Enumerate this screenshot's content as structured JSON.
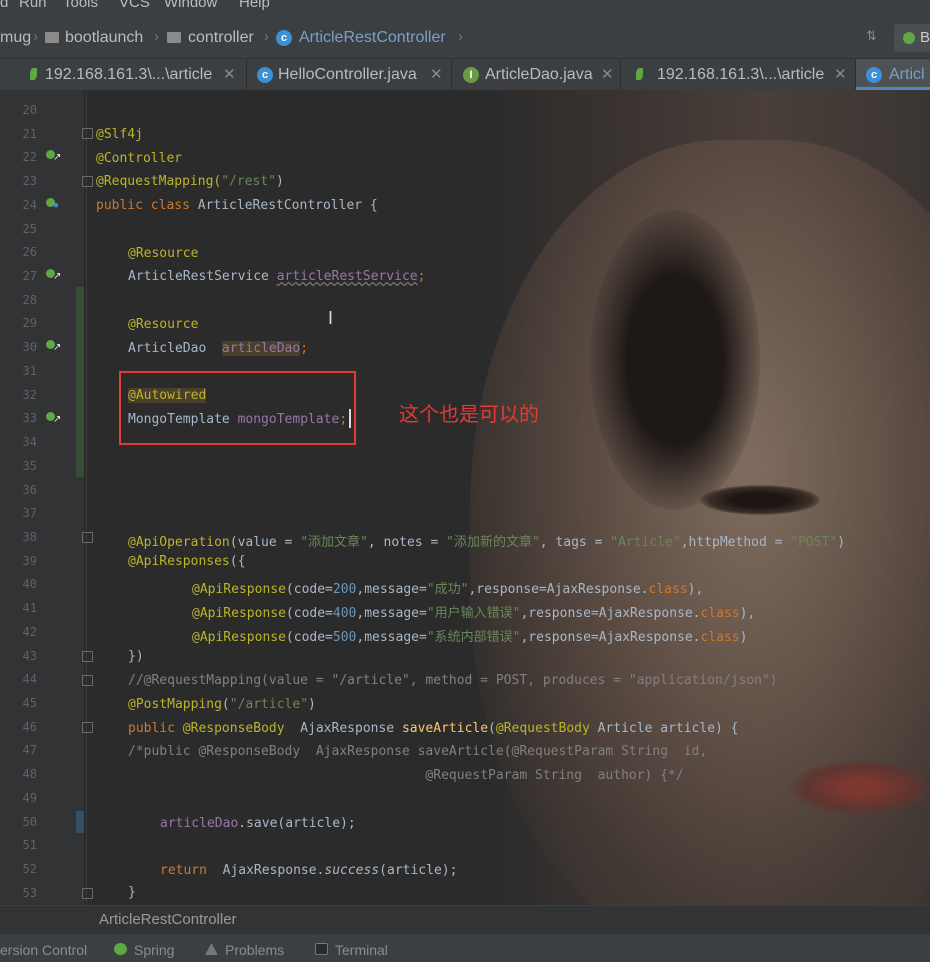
{
  "menu": {
    "items": [
      "d",
      "Run",
      "Tools",
      "VCS",
      "Window",
      "Help"
    ]
  },
  "breadcrumb": {
    "items": [
      "mug",
      "bootlaunch",
      "controller",
      "ArticleRestController"
    ],
    "right_label": "B"
  },
  "tabs": [
    {
      "label": "192.168.161.3\\...\\article",
      "icon": "mongo-leaf-icon",
      "closable": true
    },
    {
      "label": "HelloController.java",
      "icon": "class-icon",
      "closable": true
    },
    {
      "label": "ArticleDao.java",
      "icon": "interface-icon",
      "closable": true
    },
    {
      "label": "192.168.161.3\\...\\article",
      "icon": "mongo-leaf-icon",
      "closable": true
    },
    {
      "label": "Articl",
      "icon": "class-icon",
      "closable": false,
      "active": true
    }
  ],
  "editor": {
    "line_numbers": [
      "20",
      "21",
      "22",
      "23",
      "24",
      "25",
      "26",
      "27",
      "28",
      "29",
      "30",
      "31",
      "32",
      "33",
      "34",
      "35",
      "36",
      "37",
      "38",
      "39",
      "40",
      "41",
      "42",
      "43",
      "44",
      "45",
      "46",
      "47",
      "48",
      "49",
      "50",
      "51",
      "52",
      "53"
    ],
    "annotation_note": "这个也是可以的",
    "code": {
      "l21": "@Slf4j",
      "l22": "@Controller",
      "l23a": "@RequestMapping(",
      "l23b": "\"/rest\"",
      "l23c": ")",
      "l24a": "public class ",
      "l24b": "ArticleRestController {",
      "l26": "@Resource",
      "l27a": "ArticleRestService ",
      "l27b": "articleRestService",
      "l27c": ";",
      "l29": "@Resource",
      "l30a": "ArticleDao  ",
      "l30b": "articleDao",
      "l30c": ";",
      "l32": "@Autowired",
      "l33a": "MongoTemplate ",
      "l33b": "mongoTemplate",
      "l33c": ";",
      "l38a": "@ApiOperation",
      "l38b": "(value = ",
      "l38c": "\"添加文章\"",
      "l38d": ", notes = ",
      "l38e": "\"添加新的文章\"",
      "l38f": ", tags = ",
      "l38g": "\"Article\"",
      "l38h": ",httpMethod = ",
      "l38i": "\"POST\"",
      "l38j": ")",
      "l39a": "@ApiResponses",
      "l39b": "({",
      "l40a": "@ApiResponse",
      "l40b": "(code=",
      "l40c": "200",
      "l40d": ",message=",
      "l40e": "\"成功\"",
      "l40f": ",response=AjaxResponse.",
      "l40g": "class",
      "l40h": "),",
      "l41a": "@ApiResponse",
      "l41b": "(code=",
      "l41c": "400",
      "l41d": ",message=",
      "l41e": "\"用户输入错误\"",
      "l41f": ",response=AjaxResponse.",
      "l41g": "class",
      "l41h": "),",
      "l42a": "@ApiResponse",
      "l42b": "(code=",
      "l42c": "500",
      "l42d": ",message=",
      "l42e": "\"系统内部错误\"",
      "l42f": ",response=AjaxResponse.",
      "l42g": "class",
      "l42h": ")",
      "l43": "})",
      "l44": "//@RequestMapping(value = \"/article\", method = POST, produces = \"application/json\")",
      "l45a": "@PostMapping",
      "l45b": "(",
      "l45c": "\"/article\"",
      "l45d": ")",
      "l46a": "public ",
      "l46b": "@ResponseBody",
      "l46c": "  AjaxResponse ",
      "l46d": "saveArticle",
      "l46e": "(",
      "l46f": "@RequestBody",
      "l46g": " Article article) {",
      "l47": "/*public @ResponseBody  AjaxResponse saveArticle(@RequestParam String  id,",
      "l48": "                                      @RequestParam String  author) {*/",
      "l50a": "articleDao",
      "l50b": ".save(article);",
      "l52a": "return ",
      "l52b": " AjaxResponse.",
      "l52c": "success",
      "l52d": "(article);",
      "l53": "}"
    }
  },
  "bottom_breadcrumb": "ArticleRestController",
  "statusbar": {
    "items": [
      "ersion Control",
      "Spring",
      "Problems",
      "Terminal"
    ]
  },
  "colors": {
    "annotation": "#bbb529",
    "keyword": "#cc7832",
    "string": "#6a8759",
    "number": "#6897bb",
    "field": "#9876aa",
    "highlight_box": "#e53935",
    "tab_active_underline": "#4a88c7"
  }
}
